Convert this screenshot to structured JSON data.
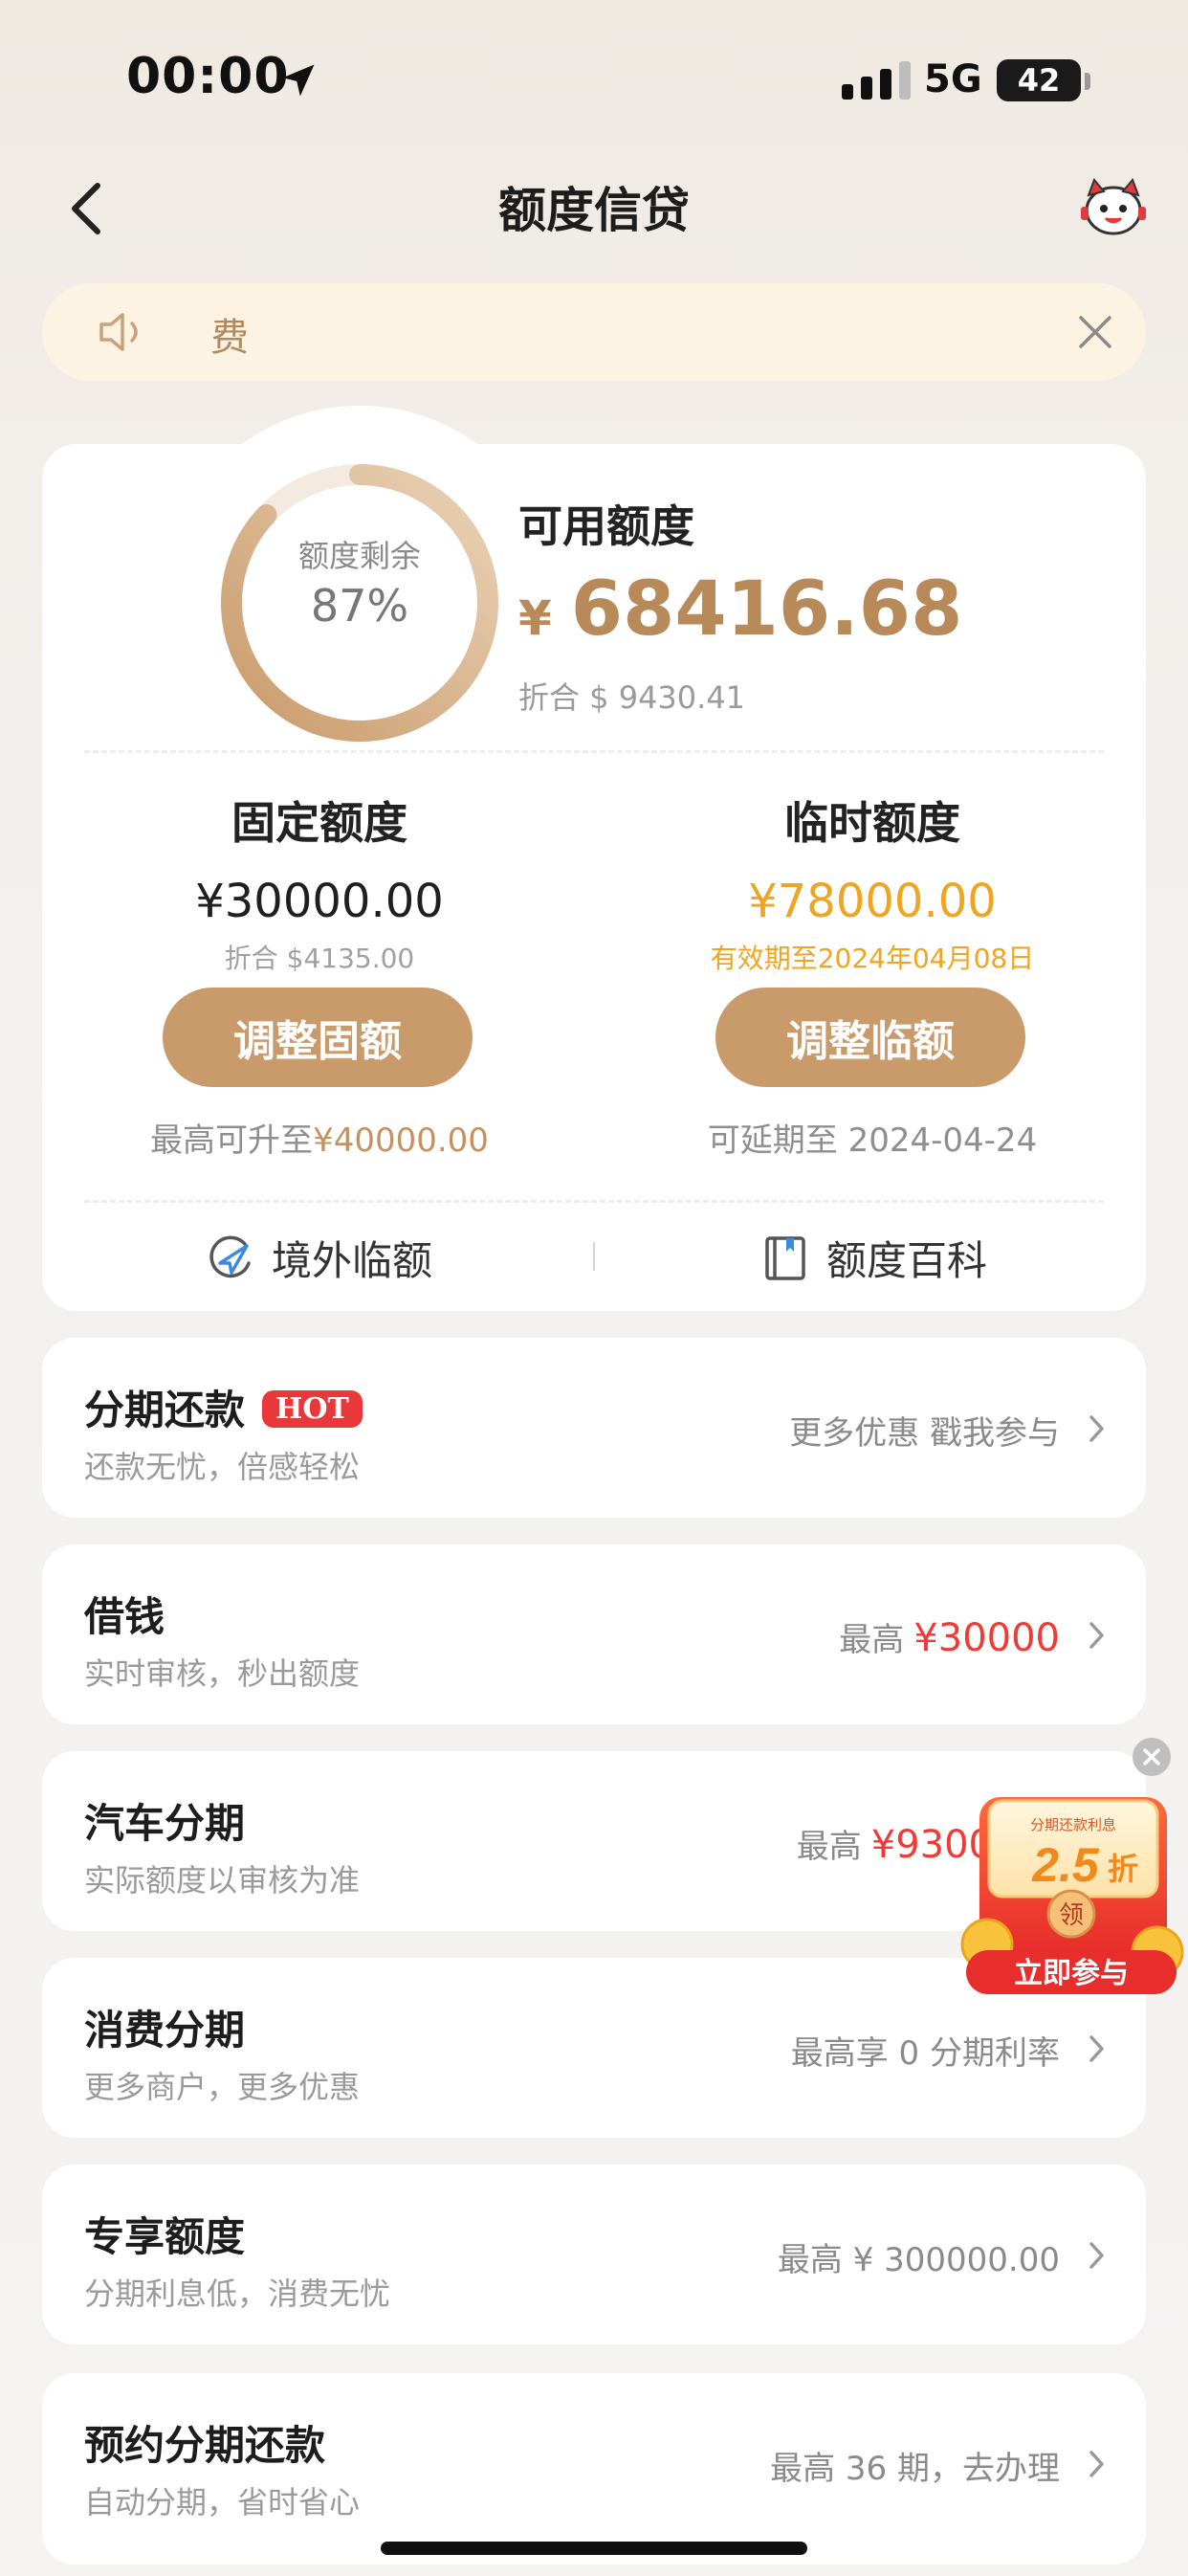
{
  "status_bar": {
    "time": "00:00",
    "network": "5G",
    "battery": "42"
  },
  "nav": {
    "title": "额度信贷"
  },
  "notice": {
    "text": "费"
  },
  "credit": {
    "ring_label": "额度剩余",
    "ring_percent": "87%",
    "ring_fraction": 0.87,
    "available_label": "可用额度",
    "currency_symbol": "¥",
    "available_value": "68416.68",
    "available_sub": "折合 $ 9430.41",
    "fixed": {
      "title": "固定额度",
      "value": "¥30000.00",
      "sub": "折合 $4135.00",
      "button": "调整固额",
      "note_prefix": "最高可升至",
      "note_amount": "¥40000.00"
    },
    "temp": {
      "title": "临时额度",
      "value": "¥78000.00",
      "sub": "有效期至2024年04月08日",
      "button": "调整临额",
      "note": "可延期至 2024-04-24"
    },
    "links": {
      "overseas": "境外临额",
      "wiki": "额度百科"
    }
  },
  "items": [
    {
      "title": "分期还款",
      "badge": "HOT",
      "subtitle": "还款无忧，倍感轻松",
      "right": "更多优惠 戳我参与",
      "right_amount": ""
    },
    {
      "title": "借钱",
      "subtitle": "实时审核，秒出额度",
      "right": "最高",
      "right_amount": "¥30000"
    },
    {
      "title": "汽车分期",
      "subtitle": "实际额度以审核为准",
      "right": "最高",
      "right_amount": "¥9300"
    },
    {
      "title": "消费分期",
      "subtitle": "更多商户，更多优惠",
      "right": "最高享 0 分期利率",
      "right_amount": ""
    },
    {
      "title": "专享额度",
      "subtitle": "分期利息低，消费无忧",
      "right": "最高 ¥ 300000.00",
      "right_amount": ""
    },
    {
      "title": "预约分期还款",
      "subtitle": "自动分期，省时省心",
      "right": "最高 36 期，去办理",
      "right_amount": ""
    }
  ],
  "promo": {
    "top_text": "分期还款利息",
    "discount": "2.5",
    "discount_unit": "折",
    "coin": "领",
    "cta": "立即参与"
  },
  "colors": {
    "accent_gold": "#c99a6a",
    "temp_gold": "#f0a520",
    "red": "#ee3b38"
  }
}
